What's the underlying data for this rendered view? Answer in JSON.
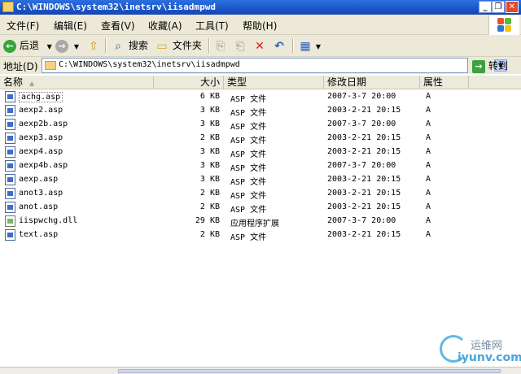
{
  "window": {
    "title": "C:\\WINDOWS\\system32\\inetsrv\\iisadmpwd",
    "minimize_glyph": "_",
    "maximize_glyph": "❐",
    "close_glyph": "✕"
  },
  "menu": [
    "文件(F)",
    "编辑(E)",
    "查看(V)",
    "收藏(A)",
    "工具(T)",
    "帮助(H)"
  ],
  "toolbar": {
    "back_label": "后退",
    "search_label": "搜索",
    "folders_label": "文件夹",
    "back_icon": "back-arrow-icon",
    "forward_icon": "forward-arrow-icon"
  },
  "address": {
    "label": "地址(D)",
    "value": "C:\\WINDOWS\\system32\\inetsrv\\iisadmpwd",
    "go_label": "转到"
  },
  "columns": [
    "名称",
    "大小",
    "类型",
    "修改日期",
    "属性"
  ],
  "files": [
    {
      "name": "achg.asp",
      "size": "6 KB",
      "type": "ASP 文件",
      "date": "2007-3-7 20:00",
      "attr": "A",
      "icon": "asp-file-icon"
    },
    {
      "name": "aexp2.asp",
      "size": "3 KB",
      "type": "ASP 文件",
      "date": "2003-2-21 20:15",
      "attr": "A",
      "icon": "asp-file-icon"
    },
    {
      "name": "aexp2b.asp",
      "size": "3 KB",
      "type": "ASP 文件",
      "date": "2007-3-7 20:00",
      "attr": "A",
      "icon": "asp-file-icon"
    },
    {
      "name": "aexp3.asp",
      "size": "2 KB",
      "type": "ASP 文件",
      "date": "2003-2-21 20:15",
      "attr": "A",
      "icon": "asp-file-icon"
    },
    {
      "name": "aexp4.asp",
      "size": "3 KB",
      "type": "ASP 文件",
      "date": "2003-2-21 20:15",
      "attr": "A",
      "icon": "asp-file-icon"
    },
    {
      "name": "aexp4b.asp",
      "size": "3 KB",
      "type": "ASP 文件",
      "date": "2007-3-7 20:00",
      "attr": "A",
      "icon": "asp-file-icon"
    },
    {
      "name": "aexp.asp",
      "size": "3 KB",
      "type": "ASP 文件",
      "date": "2003-2-21 20:15",
      "attr": "A",
      "icon": "asp-file-icon"
    },
    {
      "name": "anot3.asp",
      "size": "2 KB",
      "type": "ASP 文件",
      "date": "2003-2-21 20:15",
      "attr": "A",
      "icon": "asp-file-icon"
    },
    {
      "name": "anot.asp",
      "size": "2 KB",
      "type": "ASP 文件",
      "date": "2003-2-21 20:15",
      "attr": "A",
      "icon": "asp-file-icon"
    },
    {
      "name": "iispwchg.dll",
      "size": "29 KB",
      "type": "应用程序扩展",
      "date": "2007-3-7 20:00",
      "attr": "A",
      "icon": "dll-file-icon"
    },
    {
      "name": "text.asp",
      "size": "2 KB",
      "type": "ASP 文件",
      "date": "2003-2-21 20:15",
      "attr": "A",
      "icon": "asp-file-icon"
    }
  ],
  "watermark": {
    "line1": "运维网",
    "line2": "iyunv.com"
  },
  "colors": {
    "titlebar": "#1b55c9",
    "chrome": "#ece9d8"
  }
}
